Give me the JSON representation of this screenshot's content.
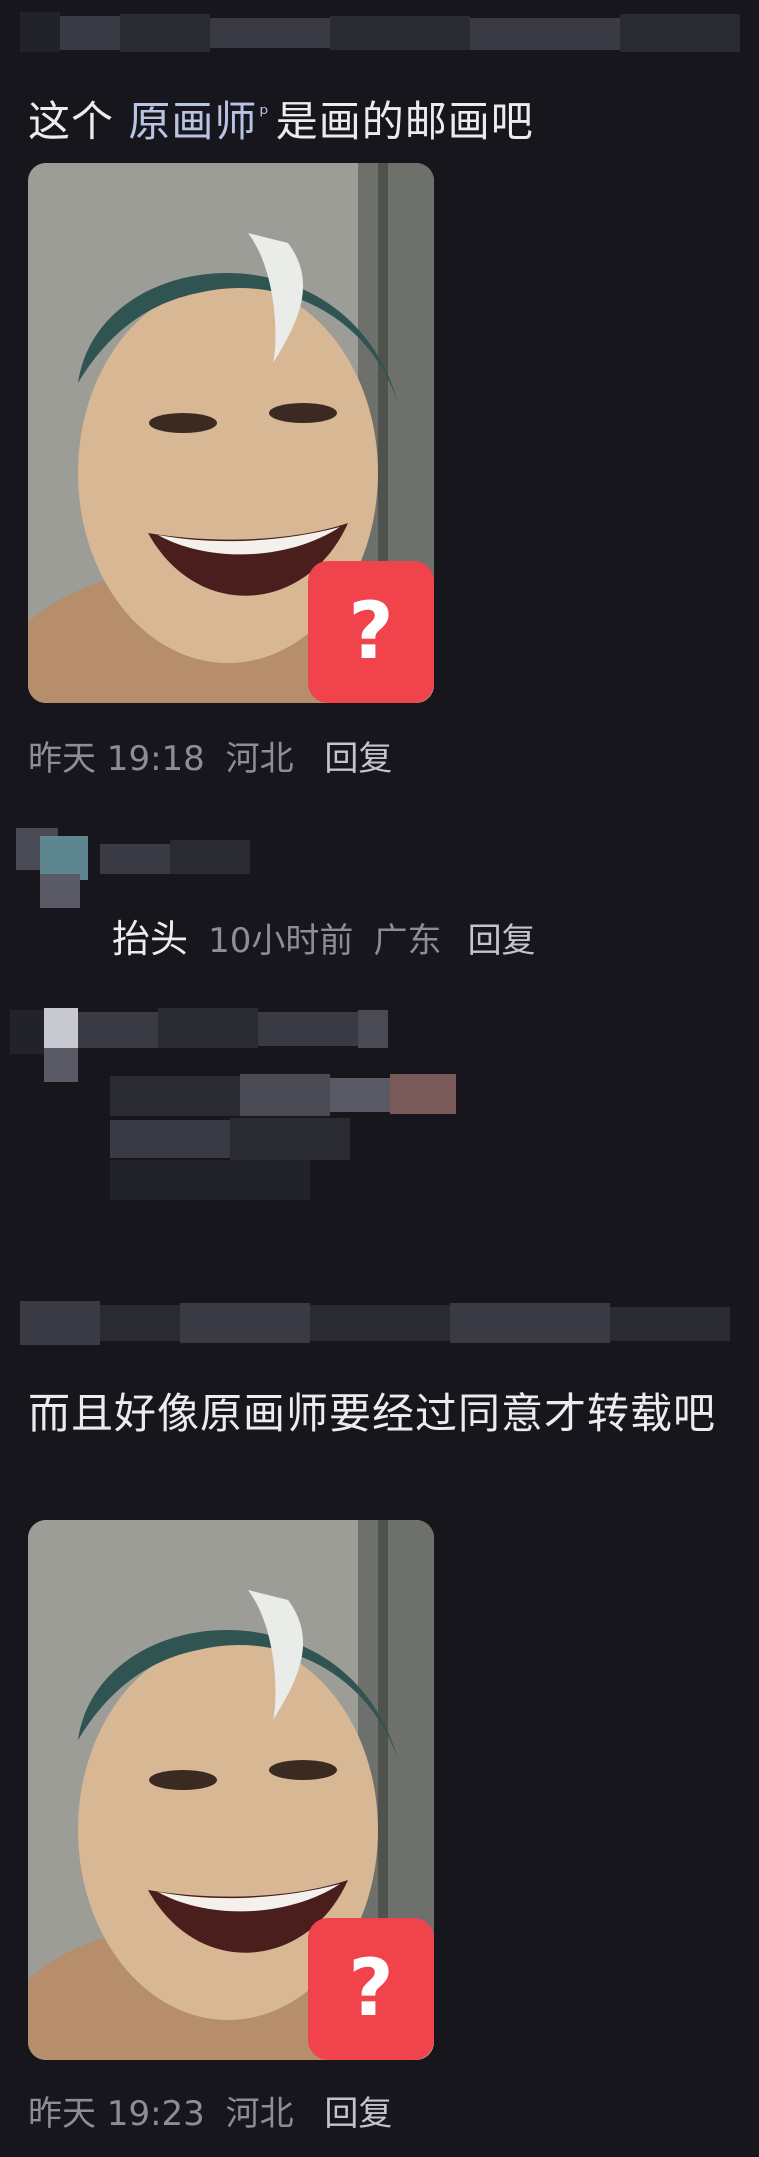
{
  "comment1": {
    "text_prefix": "这个 ",
    "keyword_link": "原画师",
    "text_suffix": "是画的邮画吧",
    "time": "昨天 19:18",
    "location": "河北",
    "reply_label": "回复"
  },
  "sticker": {
    "badge_text": "?"
  },
  "subreply1": {
    "text": "抬头",
    "time": "10小时前",
    "location": "广东",
    "reply_label": "回复"
  },
  "comment2": {
    "text": "而且好像原画师要经过同意才转载吧",
    "time": "昨天 19:23",
    "location": "河北",
    "reply_label": "回复"
  },
  "icons": {
    "search_glyph": "search-icon",
    "sticker_badge": "question-mark-icon"
  },
  "colors": {
    "background": "#16161c",
    "keyword_link": "#b9c3e6",
    "badge": "#f0434b",
    "meta_text": "#8d8d96"
  }
}
